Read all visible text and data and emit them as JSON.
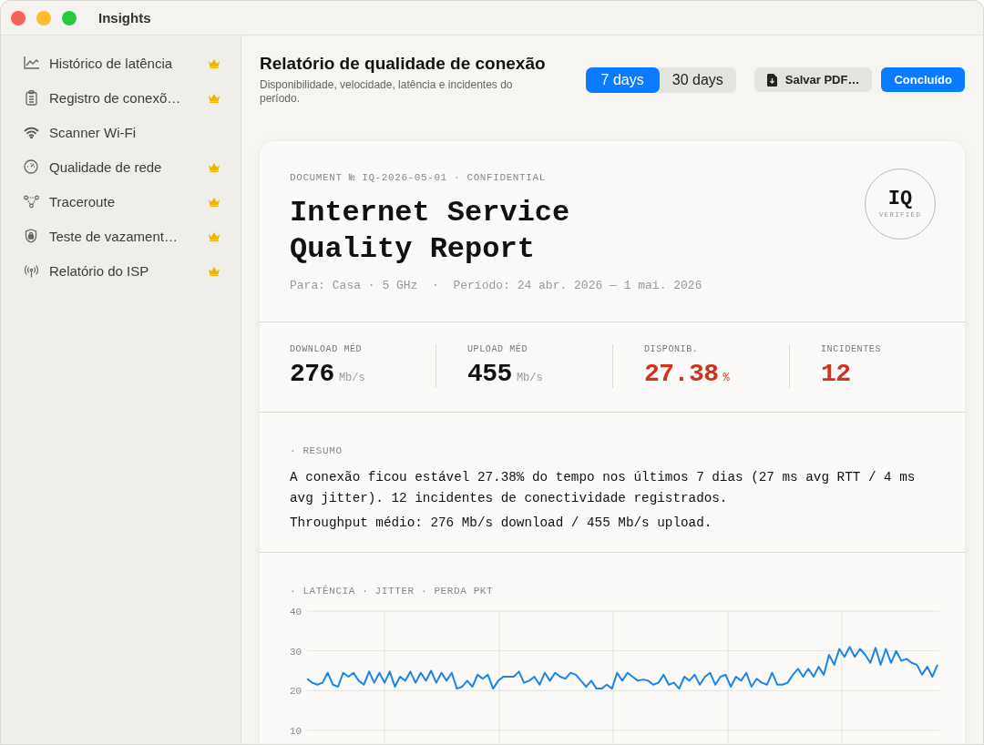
{
  "window": {
    "title": "Insights"
  },
  "sidebar": {
    "items": [
      {
        "label": "Histórico de latência",
        "premium": true
      },
      {
        "label": "Registro de conexõ…",
        "premium": true
      },
      {
        "label": "Scanner Wi-Fi",
        "premium": false
      },
      {
        "label": "Qualidade de rede",
        "premium": true
      },
      {
        "label": "Traceroute",
        "premium": true
      },
      {
        "label": "Teste de vazament…",
        "premium": true
      },
      {
        "label": "Relatório do ISP",
        "premium": true
      }
    ]
  },
  "header": {
    "title": "Relatório de qualidade de conexão",
    "subtitle": "Disponibilidade, velocidade, latência e incidentes do período.",
    "range_options": [
      {
        "label": "7 days",
        "selected": true
      },
      {
        "label": "30 days",
        "selected": false
      }
    ],
    "buttons": [
      {
        "label": "Salvar PDF…",
        "kind": "secondary"
      },
      {
        "label": "Concluído",
        "kind": "primary"
      }
    ]
  },
  "report": {
    "document_line": "DOCUMENT № IQ-2026-05-01 · CONFIDENTIAL",
    "title": "Internet Service Quality Report",
    "badge": {
      "mark": "IQ",
      "caption": "VERIFIED"
    },
    "meta": "Para: Casa · 5 GHz  ·  Período: 24 abr. 2026 — 1 mai. 2026",
    "stats": [
      {
        "label": "DOWNLOAD MÉD",
        "value": "276",
        "unit": "Mb/s",
        "alert": false
      },
      {
        "label": "UPLOAD MÉD",
        "value": "455",
        "unit": "Mb/s",
        "alert": false
      },
      {
        "label": "DISPONIB.",
        "value": "27.38",
        "unit": "%",
        "alert": true
      },
      {
        "label": "INCIDENTES",
        "value": "12",
        "alert": true
      }
    ],
    "summary": {
      "heading": "· RESUMO",
      "paragraphs": [
        "A conexão ficou estável 27.38% do tempo nos últimos 7 dias (27 ms avg RTT / 4 ms avg jitter). 12 incidentes de conectividade registrados.",
        "Throughput médio: 276 Mb/s download / 455 Mb/s upload."
      ]
    },
    "latency": {
      "heading": "· LATÊNCIA · JITTER · PERDA PKT",
      "chart_data": {
        "type": "line",
        "ylim": [
          10,
          40
        ],
        "yticks": [
          10,
          20,
          30,
          40
        ],
        "series": [
          {
            "color": "#1a84e8",
            "values": [
              23,
              22,
              21.5,
              22,
              24.5,
              21.5,
              21,
              24.5,
              23.5,
              24.5,
              22.5,
              21.5,
              24.8,
              22,
              24.5,
              22,
              24.8,
              21,
              23.5,
              22.5,
              24.8,
              22,
              24.5,
              22.5,
              25,
              22,
              24.5,
              22.5,
              24.5,
              20.5,
              21,
              22.5,
              21,
              24,
              23,
              24,
              20.5,
              22.5,
              23.5,
              23.5,
              23.5,
              24.8,
              22,
              22.5,
              23.5,
              21.5,
              24.5,
              22.5,
              24.5,
              23.5,
              23,
              24.5,
              24,
              22.5,
              21,
              22.5,
              20.5,
              20.5,
              21.5,
              20.5,
              24.5,
              22.5,
              24.5,
              23.5,
              22.5,
              22.8,
              22.5,
              21.5,
              22,
              24,
              21.5,
              22,
              20.5,
              23.5,
              22.5,
              24,
              21.5,
              23.5,
              24.5,
              21.5,
              23.5,
              24,
              21,
              23.5,
              22.5,
              24.5,
              21,
              23,
              22,
              21.5,
              24.5,
              21.5,
              21.5,
              22,
              24,
              25.5,
              23.5,
              25.5,
              23.5,
              26,
              24,
              29,
              26.5,
              30.5,
              28.5,
              31,
              28.5,
              30.5,
              29,
              27,
              30.8,
              26.5,
              30.5,
              27,
              30,
              27.5,
              28,
              27,
              26.5,
              24,
              26,
              23.5,
              26.5
            ]
          }
        ]
      }
    }
  }
}
